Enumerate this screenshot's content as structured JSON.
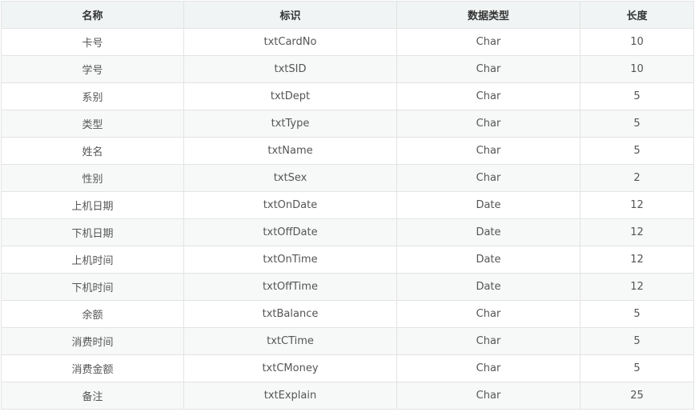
{
  "table": {
    "headers": [
      "名称",
      "标识",
      "数据类型",
      "长度"
    ],
    "rows": [
      [
        "卡号",
        "txtCardNo",
        "Char",
        "10"
      ],
      [
        "学号",
        "txtSID",
        "Char",
        "10"
      ],
      [
        "系别",
        "txtDept",
        "Char",
        "5"
      ],
      [
        "类型",
        "txtType",
        "Char",
        "5"
      ],
      [
        "姓名",
        "txtName",
        "Char",
        "5"
      ],
      [
        "性别",
        "txtSex",
        "Char",
        "2"
      ],
      [
        "上机日期",
        "txtOnDate",
        "Date",
        "12"
      ],
      [
        "下机日期",
        "txtOffDate",
        "Date",
        "12"
      ],
      [
        "上机时间",
        "txtOnTime",
        "Date",
        "12"
      ],
      [
        "下机时间",
        "txtOffTime",
        "Date",
        "12"
      ],
      [
        "余额",
        "txtBalance",
        "Char",
        "5"
      ],
      [
        "消费时间",
        "txtCTime",
        "Char",
        "5"
      ],
      [
        "消费金额",
        "txtCMoney",
        "Char",
        "5"
      ],
      [
        "备注",
        "txtExplain",
        "Char",
        "25"
      ]
    ]
  },
  "colors": {
    "header_bg": "#f1f4f4",
    "row_alt_bg": "#f7f8f8",
    "border": "#e3e3e3",
    "text": "#555555"
  }
}
